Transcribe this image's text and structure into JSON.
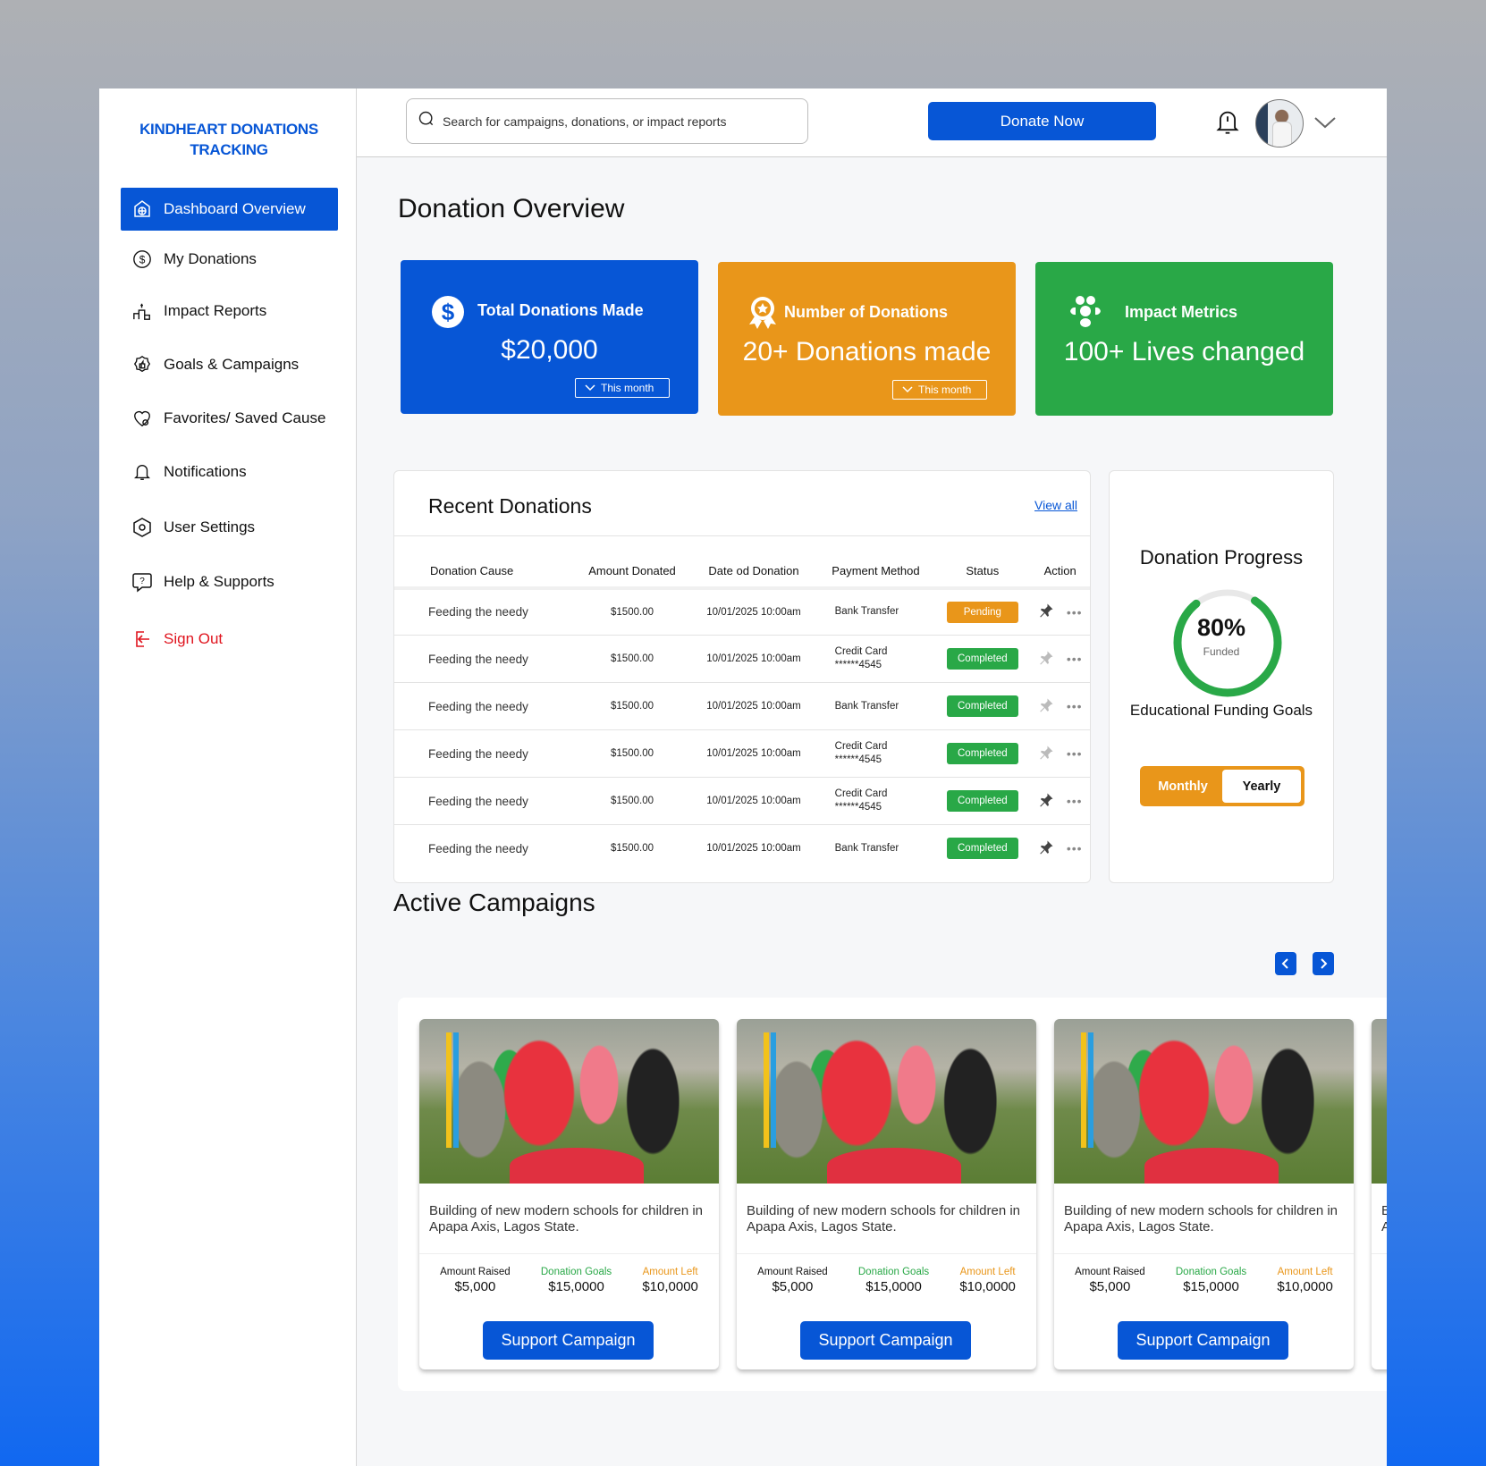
{
  "brand": {
    "title": "KINDHEART DONATIONS TRACKING"
  },
  "sidebar": {
    "items": [
      {
        "label": "Dashboard Overview",
        "icon": "dashboard-icon",
        "active": true
      },
      {
        "label": "My Donations",
        "icon": "dollar-circle-icon"
      },
      {
        "label": "Impact Reports",
        "icon": "podium-icon"
      },
      {
        "label": "Goals & Campaigns",
        "icon": "badge-thumbs-up-icon"
      },
      {
        "label": "Favorites/ Saved Cause",
        "icon": "heart-icon"
      },
      {
        "label": "Notifications",
        "icon": "bell-icon"
      },
      {
        "label": "User Settings",
        "icon": "settings-icon"
      },
      {
        "label": "Help & Supports",
        "icon": "help-chat-icon"
      },
      {
        "label": "Sign Out",
        "icon": "sign-out-icon"
      }
    ]
  },
  "header": {
    "search_placeholder": "Search for campaigns, donations, or impact reports",
    "donate_label": "Donate Now"
  },
  "overview": {
    "title": "Donation Overview",
    "cards": [
      {
        "label": "Total Donations Made",
        "value": "$20,000",
        "period": "This month",
        "color": "#0756d6"
      },
      {
        "label": "Number of Donations",
        "value": "20+ Donations made",
        "period": "This month",
        "color": "#e9961a"
      },
      {
        "label": "Impact Metrics",
        "value": "100+ Lives changed",
        "color": "#29a847"
      }
    ]
  },
  "recent": {
    "title": "Recent Donations",
    "view_all": "View all",
    "columns": [
      "Donation Cause",
      "Amount Donated",
      "Date od Donation",
      "Payment Method",
      "Status",
      "Action"
    ],
    "rows": [
      {
        "cause": "Feeding the needy",
        "amount": "$1500.00",
        "date": "10/01/2025 10:00am",
        "method": "Bank Transfer",
        "card": "",
        "status": "Pending",
        "pinned": true
      },
      {
        "cause": "Feeding the needy",
        "amount": "$1500.00",
        "date": "10/01/2025 10:00am",
        "method": "Credit Card",
        "card": "******4545",
        "status": "Completed",
        "pinned": false
      },
      {
        "cause": "Feeding the needy",
        "amount": "$1500.00",
        "date": "10/01/2025 10:00am",
        "method": "Bank Transfer",
        "card": "",
        "status": "Completed",
        "pinned": false
      },
      {
        "cause": "Feeding the needy",
        "amount": "$1500.00",
        "date": "10/01/2025 10:00am",
        "method": "Credit Card",
        "card": "******4545",
        "status": "Completed",
        "pinned": false
      },
      {
        "cause": "Feeding the needy",
        "amount": "$1500.00",
        "date": "10/01/2025 10:00am",
        "method": "Credit Card",
        "card": "******4545",
        "status": "Completed",
        "pinned": true
      },
      {
        "cause": "Feeding the needy",
        "amount": "$1500.00",
        "date": "10/01/2025 10:00am",
        "method": "Bank Transfer",
        "card": "",
        "status": "Completed",
        "pinned": true
      }
    ]
  },
  "progress": {
    "title": "Donation Progress",
    "percent": 80,
    "percent_label": "80%",
    "funded_label": "Funded",
    "goal": "Educational Funding Goals",
    "toggle": [
      "Monthly",
      "Yearly"
    ],
    "selected": "Yearly"
  },
  "campaigns": {
    "title": "Active Campaigns",
    "items": [
      {
        "desc": "Building of new modern schools for children in Apapa Axis, Lagos State.",
        "raised_label": "Amount Raised",
        "raised": "$5,000",
        "goal_label": "Donation Goals",
        "goal": "$15,0000",
        "left_label": "Amount Left",
        "left": "$10,0000",
        "button": "Support Campaign"
      },
      {
        "desc": "Building of new modern schools for children in Apapa Axis, Lagos State.",
        "raised_label": "Amount Raised",
        "raised": "$5,000",
        "goal_label": "Donation Goals",
        "goal": "$15,0000",
        "left_label": "Amount Left",
        "left": "$10,0000",
        "button": "Support Campaign"
      },
      {
        "desc": "Building of new modern schools for children in Apapa Axis, Lagos State.",
        "raised_label": "Amount Raised",
        "raised": "$5,000",
        "goal_label": "Donation Goals",
        "goal": "$15,0000",
        "left_label": "Amount Left",
        "left": "$10,0000",
        "button": "Support Campaign"
      }
    ]
  },
  "colors": {
    "primary": "#0756d6",
    "orange": "#e9961a",
    "green": "#29a847",
    "danger": "#e0141e"
  }
}
